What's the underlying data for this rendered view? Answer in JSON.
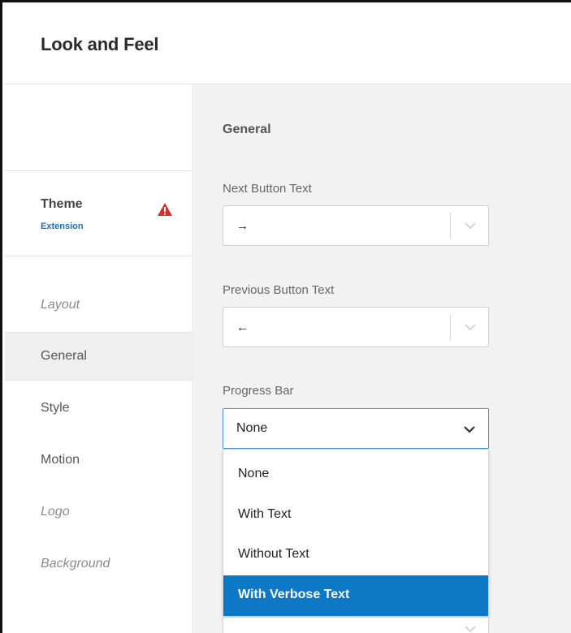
{
  "header": {
    "title": "Look and Feel"
  },
  "sidebar": {
    "theme": {
      "label": "Theme",
      "sublabel": "Extension",
      "warning_icon": "warning-triangle-icon",
      "warning_color": "#d32f2f"
    },
    "items": [
      {
        "label": "Layout"
      },
      {
        "label": "General"
      },
      {
        "label": "Style"
      },
      {
        "label": "Motion"
      },
      {
        "label": "Logo"
      },
      {
        "label": "Background"
      }
    ]
  },
  "main": {
    "section_heading": "General",
    "next_button": {
      "label": "Next Button Text",
      "value": "→"
    },
    "previous_button": {
      "label": "Previous Button Text",
      "value": "←"
    },
    "progress_bar": {
      "label": "Progress Bar",
      "value": "None",
      "options": [
        "None",
        "With Text",
        "Without Text",
        "With Verbose Text"
      ],
      "highlighted": "With Verbose Text"
    }
  },
  "colors": {
    "accent": "#0c78c6",
    "link": "#1a6fb8",
    "focus_border": "#4a90d9"
  }
}
